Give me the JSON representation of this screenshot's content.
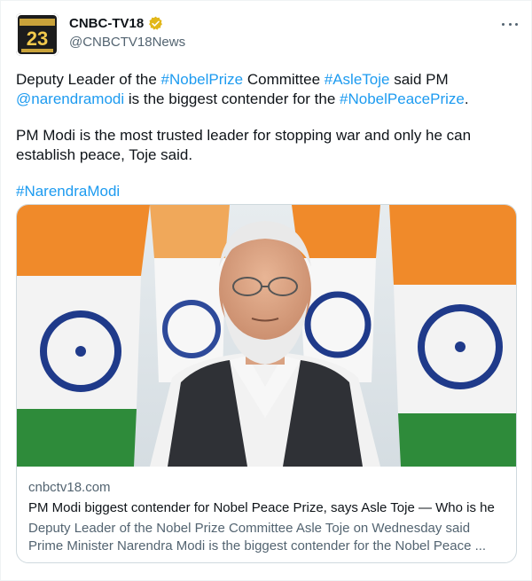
{
  "author": {
    "display_name": "CNBC-TV18",
    "handle": "@CNBCTV18News",
    "avatar_icon": "cnbc-tv18-logo-icon",
    "verified_icon": "gold-verified-badge-icon",
    "avatar_text": "23"
  },
  "menu": {
    "icon": "more-options-icon"
  },
  "tweet": {
    "line1_pre": "Deputy Leader of the ",
    "tag_nobel": "#NobelPrize",
    "line1_mid": " Committee ",
    "tag_asle": "#AsleToje",
    "line1_post": " said PM ",
    "mention_modi": "@narendramodi",
    "line1_end": " is the biggest contender for the ",
    "tag_peace": "#NobelPeacePrize",
    "line1_final": ".",
    "paragraph2": "PM Modi is the most trusted leader for stopping war and only he can establish peace, Toje said.",
    "tag_modi": "#NarendraModi"
  },
  "link_card": {
    "domain": "cnbctv18.com",
    "title": "PM Modi biggest contender for Nobel Peace Prize, says Asle Toje — Who is he",
    "description": "Deputy Leader of the Nobel Prize Committee Asle Toje on Wednesday said Prime Minister Narendra Modi is the biggest contender for the Nobel Peace ..."
  },
  "colors": {
    "link": "#1d9bf0",
    "text": "#0f1419",
    "secondary": "#536471",
    "border": "#cfd9de",
    "verified": "#e2b719",
    "saffron": "#f08a2a",
    "flag_green": "#2e8b3a",
    "chakra": "#1f3a8a"
  }
}
